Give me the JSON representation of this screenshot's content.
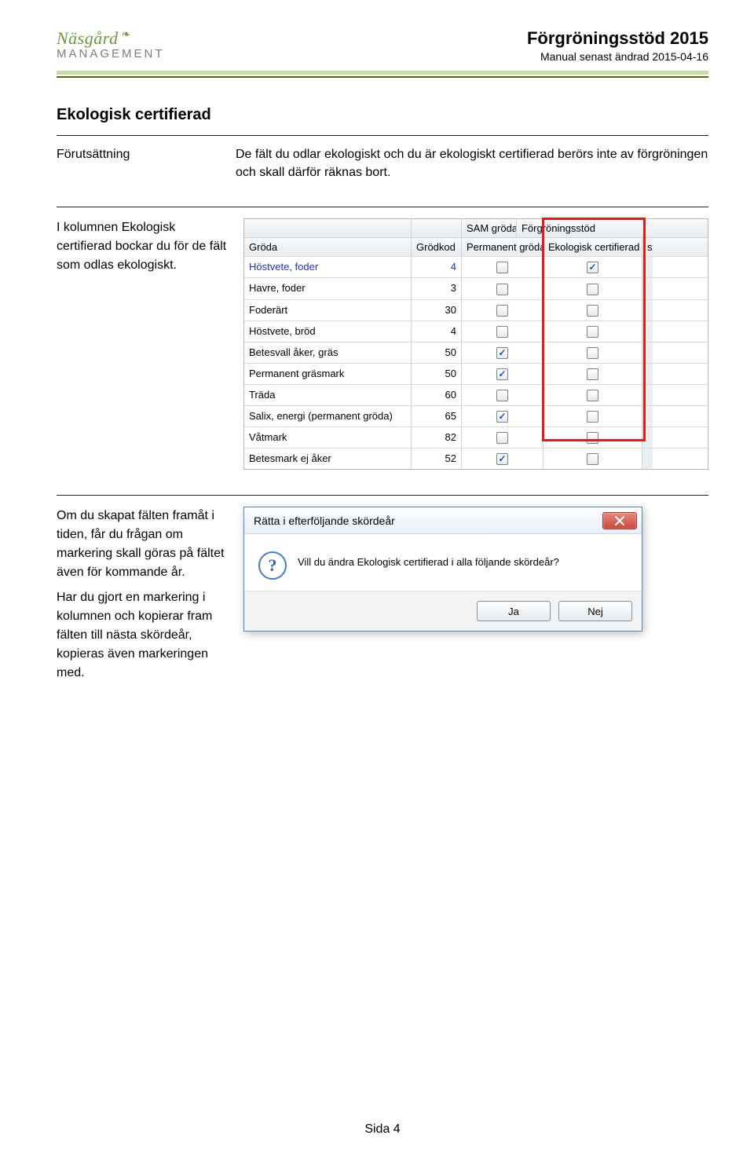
{
  "header": {
    "logo_top": "Näsgård",
    "logo_bottom": "MANAGEMENT",
    "title": "Förgröningsstöd 2015",
    "subtitle": "Manual senast ändrad 2015-04-16"
  },
  "section1": {
    "heading": "Ekologisk certifierad",
    "label": "Förutsättning",
    "text": "De fält du odlar ekologiskt och du är ekologiskt certifierad berörs inte av förgröningen och skall därför räknas bort."
  },
  "section2": {
    "text": "I kolumnen Ekologisk certifierad bockar du för de fält som odlas ekologiskt."
  },
  "grid": {
    "top_groups": {
      "sam": "SAM gröda",
      "forg": "Förgröningsstöd"
    },
    "cols": {
      "groda": "Gröda",
      "kod": "Grödkod",
      "perm": "Permanent gröda",
      "eko": "Ekologisk certifierad",
      "last": "st"
    },
    "rows": [
      {
        "groda": "Höstvete, foder",
        "kod": "4",
        "perm": false,
        "eko": true,
        "link": true
      },
      {
        "groda": "Havre, foder",
        "kod": "3",
        "perm": false,
        "eko": false
      },
      {
        "groda": "Foderärt",
        "kod": "30",
        "perm": false,
        "eko": false
      },
      {
        "groda": "Höstvete, bröd",
        "kod": "4",
        "perm": false,
        "eko": false
      },
      {
        "groda": "Betesvall åker, gräs",
        "kod": "50",
        "perm": true,
        "eko": false
      },
      {
        "groda": "Permanent gräsmark",
        "kod": "50",
        "perm": true,
        "eko": false
      },
      {
        "groda": "Träda",
        "kod": "60",
        "perm": false,
        "eko": false
      },
      {
        "groda": "Salix, energi (permanent gröda)",
        "kod": "65",
        "perm": true,
        "eko": false
      },
      {
        "groda": "Våtmark",
        "kod": "82",
        "perm": false,
        "eko": false
      },
      {
        "groda": "Betesmark ej åker",
        "kod": "52",
        "perm": true,
        "eko": false
      }
    ]
  },
  "section3": {
    "p1": "Om du skapat fälten framåt i tiden, får du frågan om markering skall göras på fältet även för kommande år.",
    "p2": "Har du gjort en markering i kolumnen och kopierar fram fälten till nästa skördeår, kopieras även markeringen med."
  },
  "dialog": {
    "title": "Rätta i efterföljande skördeår",
    "msg": "Vill du ändra Ekologisk certifierad i alla följande skördeår?",
    "yes": "Ja",
    "no": "Nej"
  },
  "footer": {
    "page": "Sida 4"
  }
}
